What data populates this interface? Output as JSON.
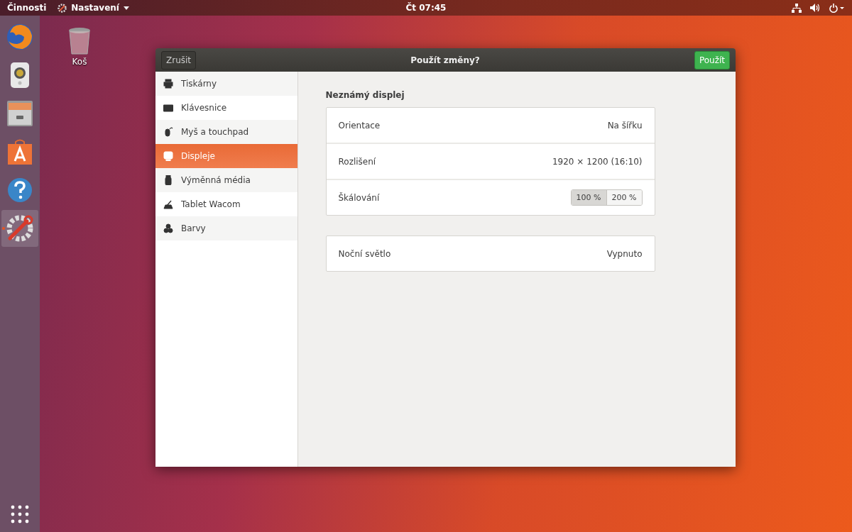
{
  "top_bar": {
    "activities": "Činnosti",
    "app_menu": "Nastavení",
    "clock": "Čt 07:45"
  },
  "dock": [
    {
      "kind": "browser",
      "active": false
    },
    {
      "kind": "speaker",
      "active": false
    },
    {
      "kind": "files",
      "active": false
    },
    {
      "kind": "store",
      "active": false
    },
    {
      "kind": "help",
      "active": false
    },
    {
      "kind": "settings",
      "active": true
    }
  ],
  "desktop_icons": [
    {
      "label": "Koš"
    }
  ],
  "window": {
    "title": "Použít změny?",
    "cancel": "Zrušit",
    "apply": "Použít"
  },
  "sidebar": {
    "items": [
      {
        "kind": "printer",
        "label": "Tiskárny",
        "selected": false
      },
      {
        "kind": "keyboard",
        "label": "Klávesnice",
        "selected": false
      },
      {
        "kind": "mouse",
        "label": "Myš a touchpad",
        "selected": false
      },
      {
        "kind": "display",
        "label": "Displeje",
        "selected": true
      },
      {
        "kind": "usb",
        "label": "Výměnná média",
        "selected": false
      },
      {
        "kind": "tablet",
        "label": "Tablet Wacom",
        "selected": false
      },
      {
        "kind": "colors",
        "label": "Barvy",
        "selected": false
      }
    ]
  },
  "display": {
    "heading": "Neznámý displej",
    "rows": [
      {
        "kind": "value",
        "label": "Orientace",
        "value": "Na šířku"
      },
      {
        "kind": "value",
        "label": "Rozlišení",
        "value": "1920 × 1200 (16:10)"
      },
      {
        "kind": "segmented",
        "label": "Škálování",
        "options": [
          {
            "label": "100 %",
            "selected": true
          },
          {
            "label": "200 %",
            "selected": false
          }
        ]
      }
    ],
    "night_light": {
      "label": "Noční světlo",
      "value": "Vypnuto"
    }
  }
}
